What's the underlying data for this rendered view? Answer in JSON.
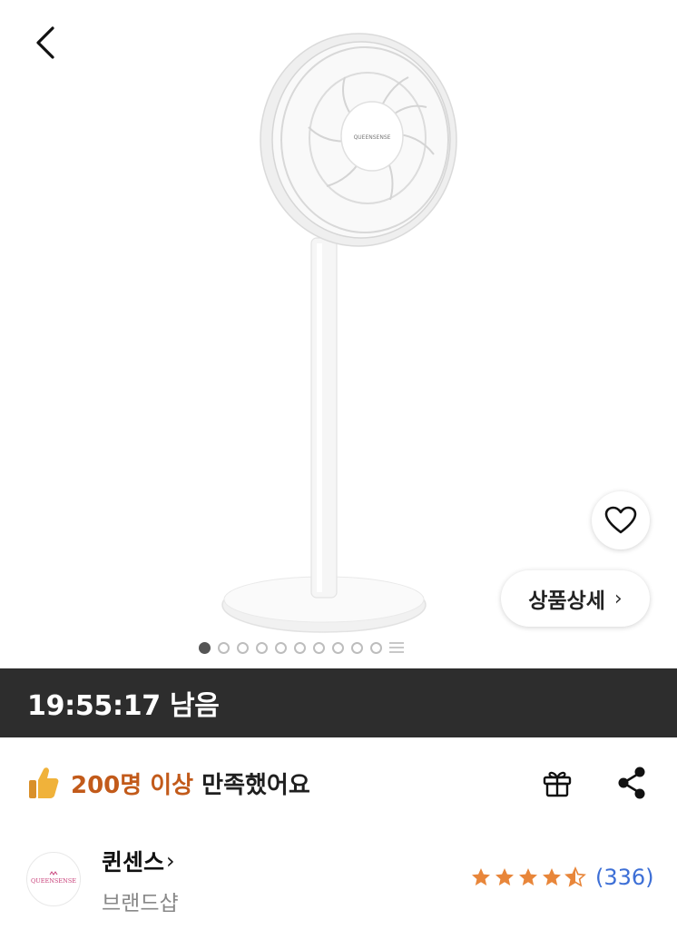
{
  "nav": {
    "back_icon": "chevron-left-icon"
  },
  "product": {
    "image_alt_icon": "stand-fan-image",
    "brand_mark_on_fan": "QUEENSENSE",
    "detail_button_label": "상품상세",
    "wishlist_icon": "heart-outline-icon",
    "carousel": {
      "total_dots": 10,
      "active_index": 0
    }
  },
  "timer": {
    "label": "19:55:17 남음"
  },
  "satisfaction": {
    "icon": "thumbs-up-icon",
    "highlight": "200명 이상",
    "suffix": " 만족했어요",
    "gift_icon": "gift-icon",
    "share_icon": "share-icon"
  },
  "brand": {
    "logo_text": "QUEENSENSE",
    "name": "퀸센스",
    "chevron": "›",
    "type": "브랜드샵"
  },
  "rating": {
    "stars": 4.5,
    "review_count": "(336)",
    "star_color": "#e8863a"
  },
  "colors": {
    "accent_orange": "#c25a1a",
    "timer_bg": "#2d2d2d",
    "link_blue": "#3d6fd6"
  }
}
